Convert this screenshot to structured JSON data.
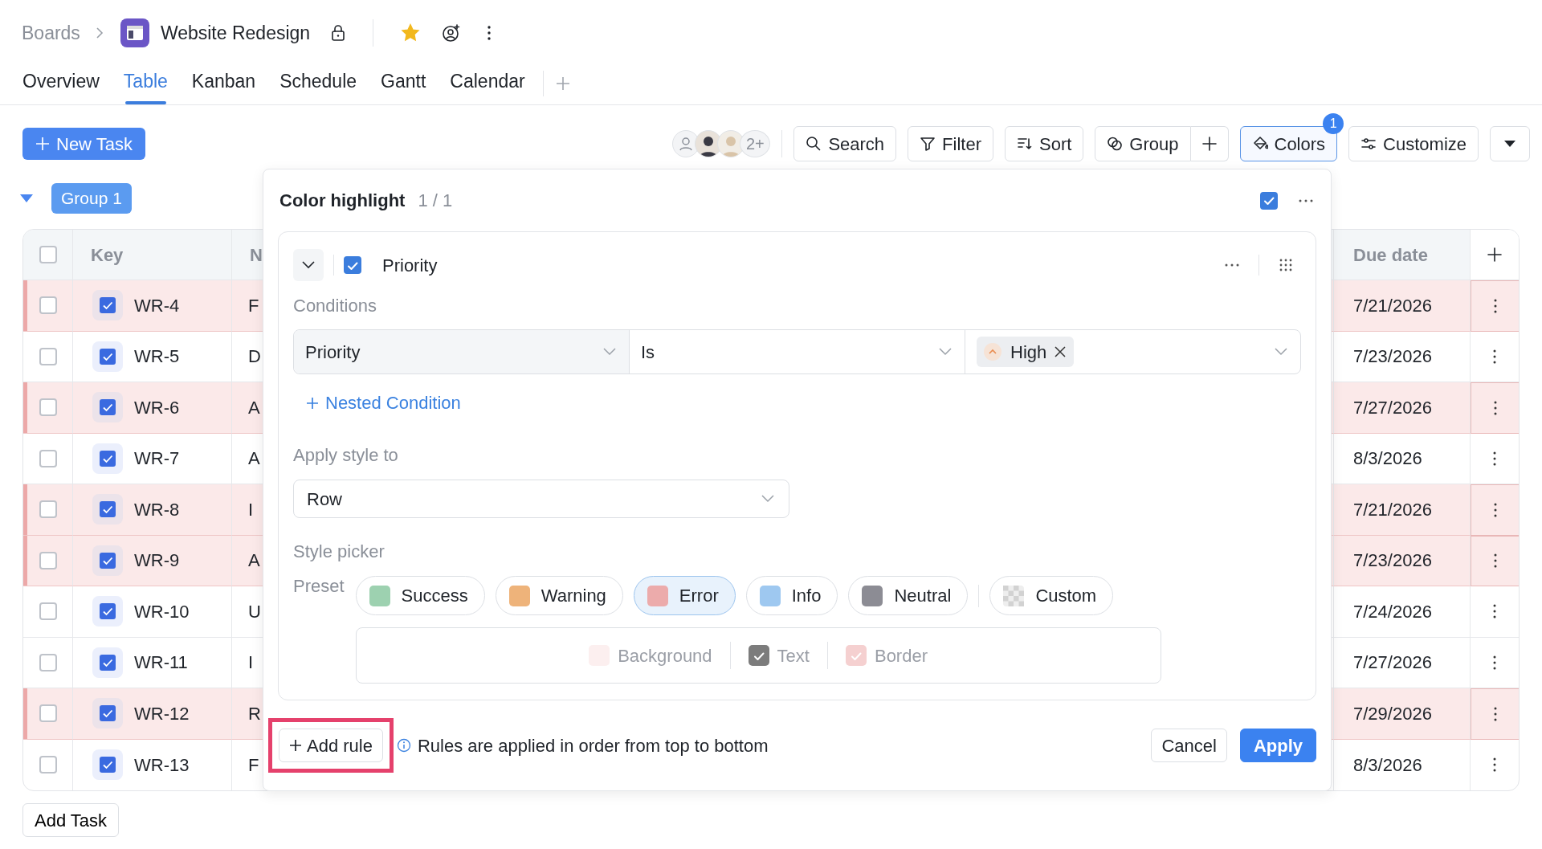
{
  "breadcrumb": {
    "parent": "Boards",
    "title": "Website Redesign",
    "starred": true
  },
  "tabs": [
    {
      "label": "Overview",
      "selected": false
    },
    {
      "label": "Table",
      "selected": true
    },
    {
      "label": "Kanban",
      "selected": false
    },
    {
      "label": "Schedule",
      "selected": false
    },
    {
      "label": "Gantt",
      "selected": false
    },
    {
      "label": "Calendar",
      "selected": false
    }
  ],
  "new_task": "New Task",
  "avatars_more": "2+",
  "toolbar": [
    {
      "kind": "search",
      "label": "Search",
      "active": false
    },
    {
      "kind": "filter",
      "label": "Filter",
      "active": false
    },
    {
      "kind": "sort",
      "label": "Sort",
      "active": false
    },
    {
      "kind": "group",
      "label": "Group",
      "active": false
    },
    {
      "kind": "add",
      "active": false
    },
    {
      "kind": "colors",
      "label": "Colors",
      "active": true,
      "badge": "1"
    },
    {
      "kind": "customize",
      "label": "Customize",
      "active": false
    },
    {
      "kind": "caret",
      "active": false
    }
  ],
  "group": {
    "label": "Group 1",
    "expanded": true
  },
  "table": {
    "all_checked": false,
    "columns": [
      "Key",
      "N",
      "Due date"
    ],
    "rows": [
      {
        "checked": false,
        "key": "WR-4",
        "name": "F",
        "due": "7/21/2026",
        "highlighted": true
      },
      {
        "checked": false,
        "key": "WR-5",
        "name": "D",
        "due": "7/23/2026",
        "highlighted": false
      },
      {
        "checked": false,
        "key": "WR-6",
        "name": "A",
        "due": "7/27/2026",
        "highlighted": true
      },
      {
        "checked": false,
        "key": "WR-7",
        "name": "A",
        "due": "8/3/2026",
        "highlighted": false
      },
      {
        "checked": false,
        "key": "WR-8",
        "name": "I",
        "due": "7/21/2026",
        "highlighted": true
      },
      {
        "checked": false,
        "key": "WR-9",
        "name": "A",
        "due": "7/23/2026",
        "highlighted": true
      },
      {
        "checked": false,
        "key": "WR-10",
        "name": "U",
        "due": "7/24/2026",
        "highlighted": false
      },
      {
        "checked": false,
        "key": "WR-11",
        "name": "I",
        "due": "7/27/2026",
        "highlighted": false
      },
      {
        "checked": false,
        "key": "WR-12",
        "name": "R",
        "due": "7/29/2026",
        "highlighted": true
      },
      {
        "checked": false,
        "key": "WR-13",
        "name": "F",
        "due": "8/3/2026",
        "highlighted": false
      }
    ]
  },
  "add_task": "Add Task",
  "popup": {
    "title": "Color highlight",
    "count": "1 / 1",
    "enabled": true,
    "rule": {
      "expanded": true,
      "enabled": true,
      "field": "Priority",
      "conditions_label": "Conditions",
      "condition": {
        "field": "Priority",
        "operator": "Is",
        "value": "High"
      },
      "nested_link": "Nested Condition",
      "apply_label": "Apply style to",
      "apply_to": "Row",
      "style_label": "Style picker",
      "preset_label": "Preset",
      "presets": [
        {
          "kind": "color",
          "label": "Success",
          "color": "#9dd1b0",
          "selected": false
        },
        {
          "kind": "color",
          "label": "Warning",
          "color": "#eeb37a",
          "selected": false
        },
        {
          "kind": "color",
          "label": "Error",
          "color": "#ecabab",
          "selected": true
        },
        {
          "kind": "color",
          "label": "Info",
          "color": "#9ec8f0",
          "selected": false
        },
        {
          "kind": "color",
          "label": "Neutral",
          "color": "#8c8c94",
          "selected": false
        },
        {
          "kind": "custom",
          "label": "Custom",
          "selected": false
        }
      ],
      "options": [
        {
          "label": "Background",
          "checked": false,
          "color": "#fcefef"
        },
        {
          "label": "Text",
          "checked": true,
          "color": "#7c7c7c"
        },
        {
          "label": "Border",
          "checked": true,
          "color": "#f5d0d0"
        }
      ]
    },
    "add_rule": "Add rule",
    "hint": "Rules are applied in order from top to bottom",
    "cancel": "Cancel",
    "apply": "Apply"
  }
}
